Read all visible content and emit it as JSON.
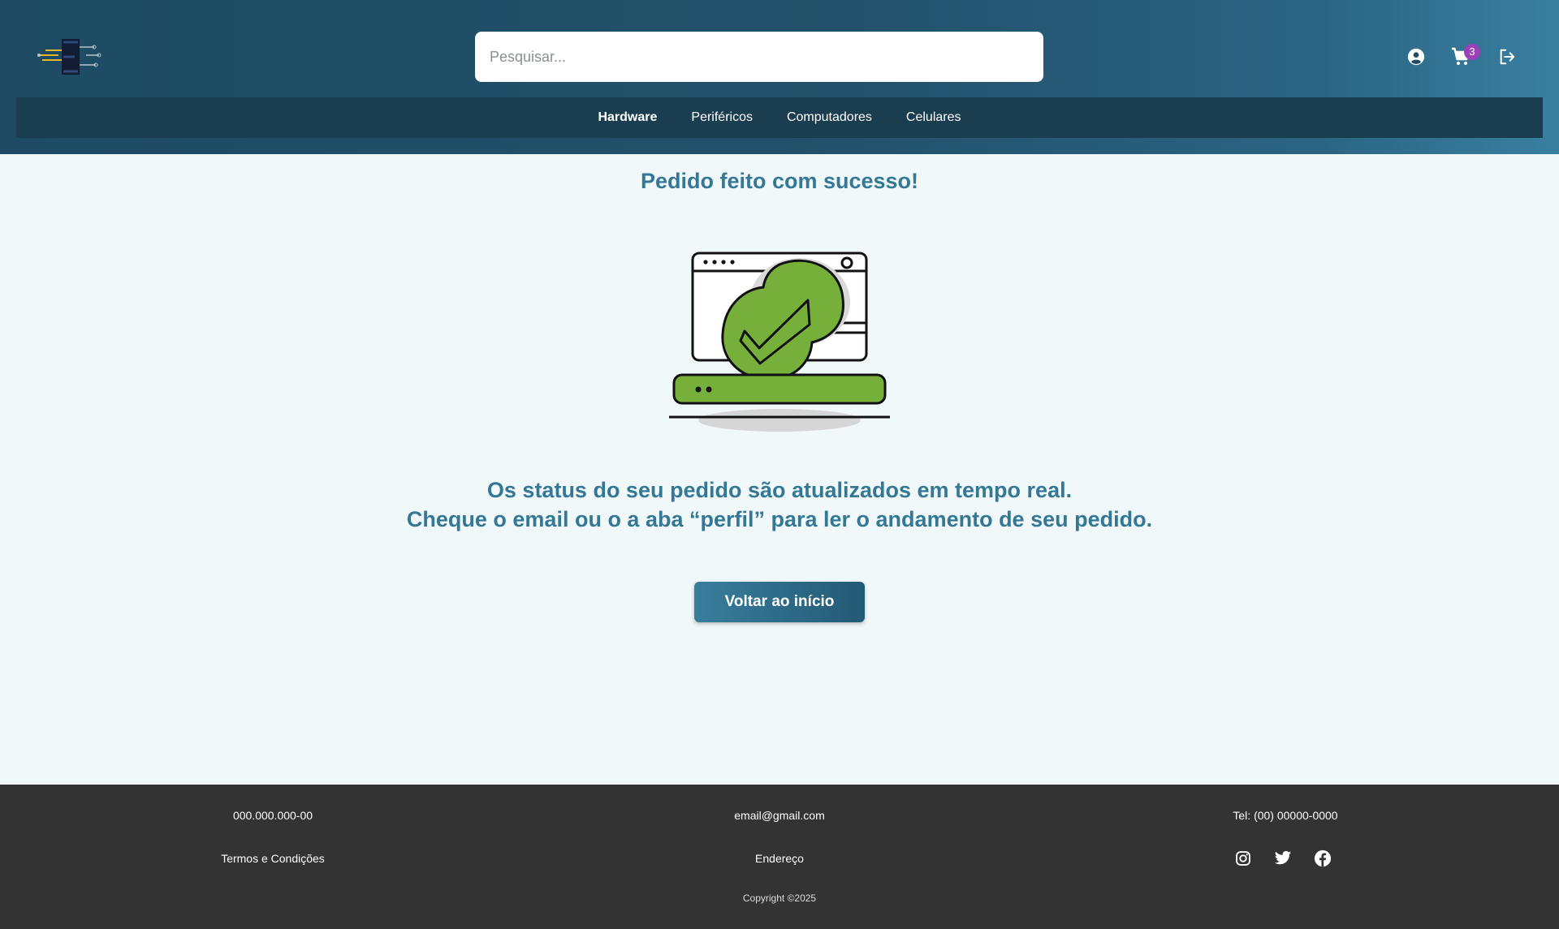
{
  "header": {
    "search_placeholder": "Pesquisar...",
    "cart_count": "3",
    "icons": [
      "logo-icon",
      "user-icon",
      "cart-icon",
      "logout-icon"
    ]
  },
  "nav": {
    "items": [
      {
        "label": "Hardware",
        "active": true
      },
      {
        "label": "Periféricos",
        "active": false
      },
      {
        "label": "Computadores",
        "active": false
      },
      {
        "label": "Celulares",
        "active": false
      }
    ]
  },
  "main": {
    "title": "Pedido feito com sucesso!",
    "message_line1": "Os status do seu pedido são atualizados em tempo real.",
    "message_line2": "Cheque o email ou o a aba “perfil” para ler o andamento de seu pedido.",
    "back_button": "Voltar ao início"
  },
  "footer": {
    "document": "000.000.000-00",
    "email": "email@gmail.com",
    "phone": "Tel: (00) 00000-0000",
    "terms": "Termos e Condições",
    "address": "Endereço",
    "copyright": "Copyright ©2025",
    "socials": [
      "instagram-icon",
      "twitter-icon",
      "facebook-icon"
    ]
  },
  "colors": {
    "accent": "#347896",
    "header_dark": "#1b3d50",
    "success_green": "#76b03b",
    "badge": "#9c3fb8",
    "footer_bg": "#333333"
  }
}
